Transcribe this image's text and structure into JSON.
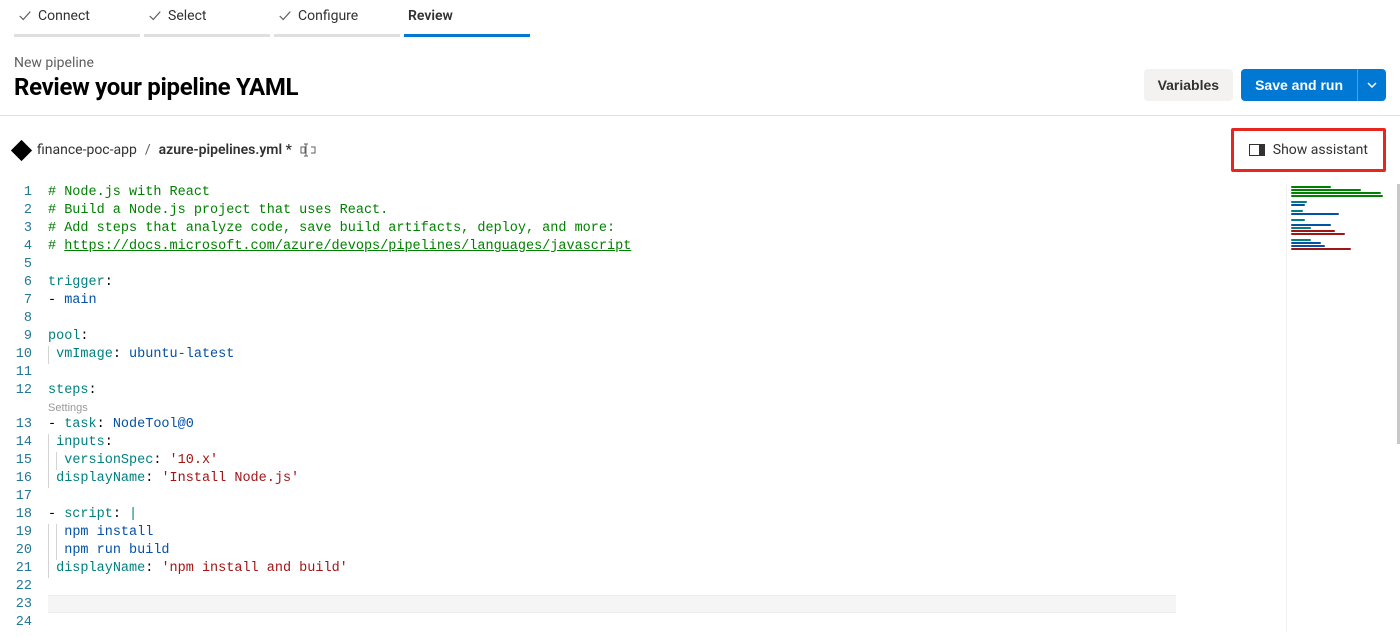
{
  "stepper": {
    "steps": [
      {
        "label": "Connect",
        "done": true,
        "active": false
      },
      {
        "label": "Select",
        "done": true,
        "active": false
      },
      {
        "label": "Configure",
        "done": true,
        "active": false
      },
      {
        "label": "Review",
        "done": false,
        "active": true
      }
    ]
  },
  "header": {
    "crumb": "New pipeline",
    "title": "Review your pipeline YAML",
    "variables_label": "Variables",
    "save_run_label": "Save and run"
  },
  "file": {
    "repo": "finance-poc-app",
    "sep": "/",
    "name": "azure-pipelines.yml",
    "dirty": "*"
  },
  "assistant": {
    "label": "Show assistant"
  },
  "codelens": {
    "settings": "Settings"
  },
  "yaml": {
    "l1": "# Node.js with React",
    "l2": "# Build a Node.js project that uses React.",
    "l3": "# Add steps that analyze code, save build artifacts, deploy, and more:",
    "l4a": "# ",
    "l4b": "https://docs.microsoft.com/azure/devops/pipelines/languages/javascript",
    "trigger": "trigger",
    "main": "main",
    "pool": "pool",
    "vmImage": "vmImage",
    "ubuntu": "ubuntu-latest",
    "steps": "steps",
    "task": "task",
    "nodetool": "NodeTool@0",
    "inputs": "inputs",
    "versionSpec": "versionSpec",
    "v10": "'10.x'",
    "displayName": "displayName",
    "installnode": "'Install Node.js'",
    "script": "script",
    "pipe": "|",
    "npm_install": "npm install",
    "npm_build": "npm run build",
    "npm_dn": "'npm install and build'"
  }
}
